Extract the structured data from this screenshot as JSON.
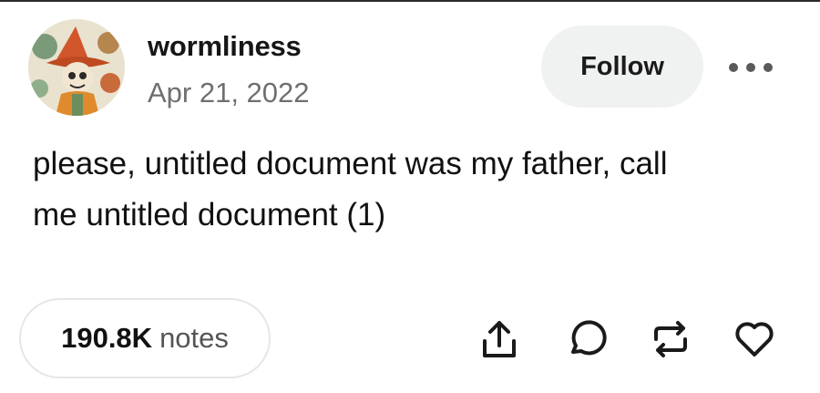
{
  "post": {
    "username": "wormliness",
    "date": "Apr 21, 2022",
    "follow_label": "Follow",
    "body_lines": [
      "please, untitled document was my father, call",
      "me untitled document (1)"
    ]
  },
  "footer": {
    "notes_count": "190.8K",
    "notes_label": "notes"
  },
  "icons": {
    "more": "more-dots-icon",
    "share": "share-icon",
    "reply": "reply-icon",
    "reblog": "reblog-icon",
    "like": "heart-icon"
  },
  "colors": {
    "text": "#121212",
    "muted": "#6f6f6f",
    "follow_bg": "#f0f1f1",
    "pill_border": "#e6e6e6"
  }
}
